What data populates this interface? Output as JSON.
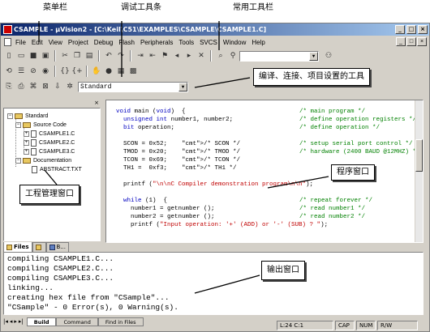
{
  "window": {
    "title": "CSAMPLE - µVision2 - [C:\\Keil\\C51\\EXAMPLES\\CSAMPLE\\CSAMPLE1.C]",
    "minimize": "_",
    "maximize": "□",
    "close": "×"
  },
  "menubar": {
    "items": [
      "File",
      "Edit",
      "View",
      "Project",
      "Debug",
      "Flash",
      "Peripherals",
      "Tools",
      "SVCS",
      "Window",
      "Help"
    ]
  },
  "toolbar": {
    "find_combo_value": "",
    "target_combo_value": "Standard"
  },
  "project": {
    "root": "Standard",
    "source_group": "Source Code",
    "source_files": [
      "CSAMPLE1.C",
      "CSAMPLE2.C",
      "CSAMPLE3.C"
    ],
    "doc_group": "Documentation",
    "doc_files": [
      "ABSTRACT.TXT"
    ],
    "tabs": [
      "Files",
      "",
      "B..."
    ]
  },
  "editor": {
    "lines": [
      {
        "code": "void main (void)  {",
        "comment": "/* main program */"
      },
      {
        "code": "  unsigned int number1, number2;",
        "comment": "/* define operation registers */"
      },
      {
        "code": "  bit operation;",
        "comment": "/* define operation */"
      },
      {
        "code": "",
        "comment": ""
      },
      {
        "code": "  SCON = 0x52;    /* SCON */",
        "comment": "/* setup serial port control */"
      },
      {
        "code": "  TMOD = 0x20;    /* TMOD */",
        "comment": "/* hardware (2400 BAUD @12MHZ) */"
      },
      {
        "code": "  TCON = 0x69;    /* TCON */",
        "comment": ""
      },
      {
        "code": "  TH1 =  0xf3;    /* TH1 */",
        "comment": ""
      },
      {
        "code": "",
        "comment": ""
      },
      {
        "code": "  printf (\"\\n\\nC Compiler demonstration program\\n\\n\");",
        "comment": ""
      },
      {
        "code": "",
        "comment": ""
      },
      {
        "code": "  while (1)  {",
        "comment": "/* repeat forever */"
      },
      {
        "code": "    number1 = getnumber ();",
        "comment": "/* read number1 */"
      },
      {
        "code": "    number2 = getnumber ();",
        "comment": "/* read number2 */"
      },
      {
        "code": "    printf (\"Input operation: '+' (ADD) or '-' (SUB) ? \");",
        "comment": ""
      }
    ]
  },
  "output": {
    "lines": [
      "compiling CSAMPLE1.C...",
      "compiling CSAMPLE2.C...",
      "compiling CSAMPLE3.C...",
      "linking...",
      "creating hex file from \"CSample\"...",
      "\"CSample\" - 0 Error(s), 0 Warning(s)."
    ],
    "tabs": [
      "Build",
      "Command",
      "Find in Files"
    ]
  },
  "statusbar": {
    "position": "L:24 C:1",
    "caps": "CAP",
    "num": "NUM",
    "rw": "R/W"
  },
  "callouts": {
    "menubar": "菜单栏",
    "debug_toolbar": "调试工具条",
    "common_toolbar": "常用工具栏",
    "build_toolbar": "编译、连接、项目设置的工具",
    "program_window": "程序窗口",
    "project_window": "工程管理窗口",
    "output_window": "输出窗口"
  }
}
